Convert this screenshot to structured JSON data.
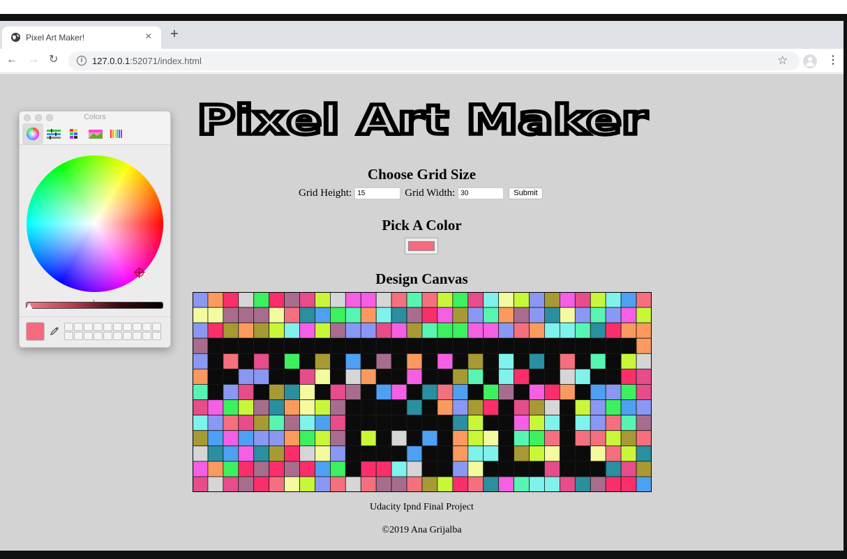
{
  "browser": {
    "tab_title": "Pixel Art Maker!",
    "tab_close": "×",
    "new_tab": "+",
    "url_host": "127.0.0.1",
    "url_rest": ":52071/index.html"
  },
  "page": {
    "title": "Pixel Art Maker",
    "grid_heading": "Choose Grid Size",
    "grid_height_label": "Grid Height:",
    "grid_height_value": "15",
    "grid_width_label": "Grid Width:",
    "grid_width_value": "30",
    "submit_label": "Submit",
    "color_heading": "Pick A Color",
    "selected_color": "#f56a7e",
    "canvas_heading": "Design Canvas",
    "footer_project": "Udacity Ipnd Final Project",
    "footer_copyright": "©2019 Ana Grijalba"
  },
  "colors_panel": {
    "title": "Colors",
    "tabs": [
      "color-wheel-icon",
      "color-sliders-icon",
      "color-palettes-icon",
      "image-palettes-icon",
      "pencils-icon"
    ],
    "current_color": "#f56a7e",
    "brightness": 0.0
  },
  "canvas_grid": {
    "rows": 13,
    "cols": 30,
    "palette": [
      "#f5707e",
      "#c8f73a",
      "#4ea0f2",
      "#f45fe4",
      "#fb9a5e",
      "#2a8f9f",
      "#58f5b2",
      "#a79a34",
      "#fb2e6c",
      "#8a98f3",
      "#3df060",
      "#f3fb9e",
      "#7ff2ec",
      "#a86d8c",
      "#e64d8a",
      "#d6d6d6"
    ],
    "black": "#0b0b0b",
    "dark_cells": [
      [
        3,
        1
      ],
      [
        3,
        2
      ],
      [
        3,
        3
      ],
      [
        3,
        4
      ],
      [
        3,
        5
      ],
      [
        3,
        6
      ],
      [
        3,
        7
      ],
      [
        3,
        8
      ],
      [
        3,
        9
      ],
      [
        3,
        10
      ],
      [
        3,
        11
      ],
      [
        3,
        12
      ],
      [
        3,
        13
      ],
      [
        3,
        14
      ],
      [
        3,
        15
      ],
      [
        3,
        16
      ],
      [
        3,
        17
      ],
      [
        3,
        18
      ],
      [
        3,
        19
      ],
      [
        3,
        20
      ],
      [
        3,
        21
      ],
      [
        3,
        22
      ],
      [
        3,
        23
      ],
      [
        3,
        24
      ],
      [
        3,
        25
      ],
      [
        3,
        26
      ],
      [
        3,
        27
      ],
      [
        3,
        28
      ],
      [
        4,
        1
      ],
      [
        4,
        3
      ],
      [
        4,
        5
      ],
      [
        4,
        7
      ],
      [
        4,
        9
      ],
      [
        4,
        11
      ],
      [
        4,
        13
      ],
      [
        4,
        15
      ],
      [
        4,
        17
      ],
      [
        4,
        19
      ],
      [
        4,
        21
      ],
      [
        4,
        23
      ],
      [
        4,
        25
      ],
      [
        4,
        27
      ],
      [
        5,
        1
      ],
      [
        5,
        2
      ],
      [
        5,
        5
      ],
      [
        5,
        6
      ],
      [
        5,
        9
      ],
      [
        5,
        12
      ],
      [
        5,
        13
      ],
      [
        5,
        15
      ],
      [
        5,
        16
      ],
      [
        5,
        19
      ],
      [
        5,
        22
      ],
      [
        5,
        23
      ],
      [
        5,
        26
      ],
      [
        5,
        27
      ],
      [
        6,
        1
      ],
      [
        6,
        4
      ],
      [
        6,
        8
      ],
      [
        6,
        11
      ],
      [
        6,
        14
      ],
      [
        6,
        18
      ],
      [
        6,
        21
      ],
      [
        6,
        25
      ],
      [
        7,
        10
      ],
      [
        7,
        11
      ],
      [
        7,
        12
      ],
      [
        7,
        13
      ],
      [
        7,
        15
      ],
      [
        7,
        20
      ],
      [
        7,
        24
      ],
      [
        8,
        10
      ],
      [
        8,
        11
      ],
      [
        8,
        12
      ],
      [
        8,
        13
      ],
      [
        8,
        14
      ],
      [
        8,
        15
      ],
      [
        8,
        16
      ],
      [
        8,
        19
      ],
      [
        8,
        20
      ],
      [
        8,
        24
      ],
      [
        9,
        10
      ],
      [
        9,
        12
      ],
      [
        9,
        14
      ],
      [
        9,
        16
      ],
      [
        9,
        20
      ],
      [
        9,
        24
      ],
      [
        10,
        10
      ],
      [
        10,
        11
      ],
      [
        10,
        12
      ],
      [
        10,
        13
      ],
      [
        10,
        15
      ],
      [
        10,
        16
      ],
      [
        10,
        20
      ],
      [
        10,
        24
      ],
      [
        10,
        25
      ],
      [
        11,
        10
      ],
      [
        11,
        15
      ],
      [
        11,
        16
      ],
      [
        11,
        19
      ],
      [
        11,
        20
      ],
      [
        11,
        21
      ],
      [
        11,
        22
      ],
      [
        11,
        24
      ],
      [
        11,
        25
      ],
      [
        11,
        26
      ]
    ]
  }
}
